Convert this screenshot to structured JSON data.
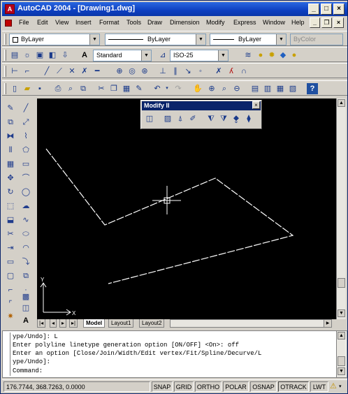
{
  "window": {
    "title": "AutoCAD 2004 - [Drawing1.dwg]"
  },
  "menu": [
    "File",
    "Edit",
    "View",
    "Insert",
    "Format",
    "Tools",
    "Draw",
    "Dimension",
    "Modify",
    "Express",
    "Window",
    "Help"
  ],
  "properties": {
    "layer": "ByLayer",
    "linetype": "ByLayer",
    "lineweight": "ByLayer",
    "plotstyle": "ByColor"
  },
  "styles": {
    "text_style": "Standard",
    "dim_style": "ISO-25"
  },
  "modify2": {
    "title": "Modify II"
  },
  "tabs": [
    "Model",
    "Layout1",
    "Layout2"
  ],
  "ucs": {
    "x": "X",
    "y": "Y"
  },
  "command": {
    "lines": [
      "ype/Undo]: L",
      "Enter polyline linetype generation option [ON/OFF] <On>: off",
      "Enter an option [Close/Join/Width/Edit vertex/Fit/Spline/Decurve/L",
      "ype/Undo]:"
    ],
    "prompt": "Command:"
  },
  "status": {
    "coords": "176.7744, 368.7263, 0.0000",
    "buttons": [
      "SNAP",
      "GRID",
      "ORTHO",
      "POLAR",
      "OSNAP",
      "OTRACK",
      "LWT"
    ]
  }
}
